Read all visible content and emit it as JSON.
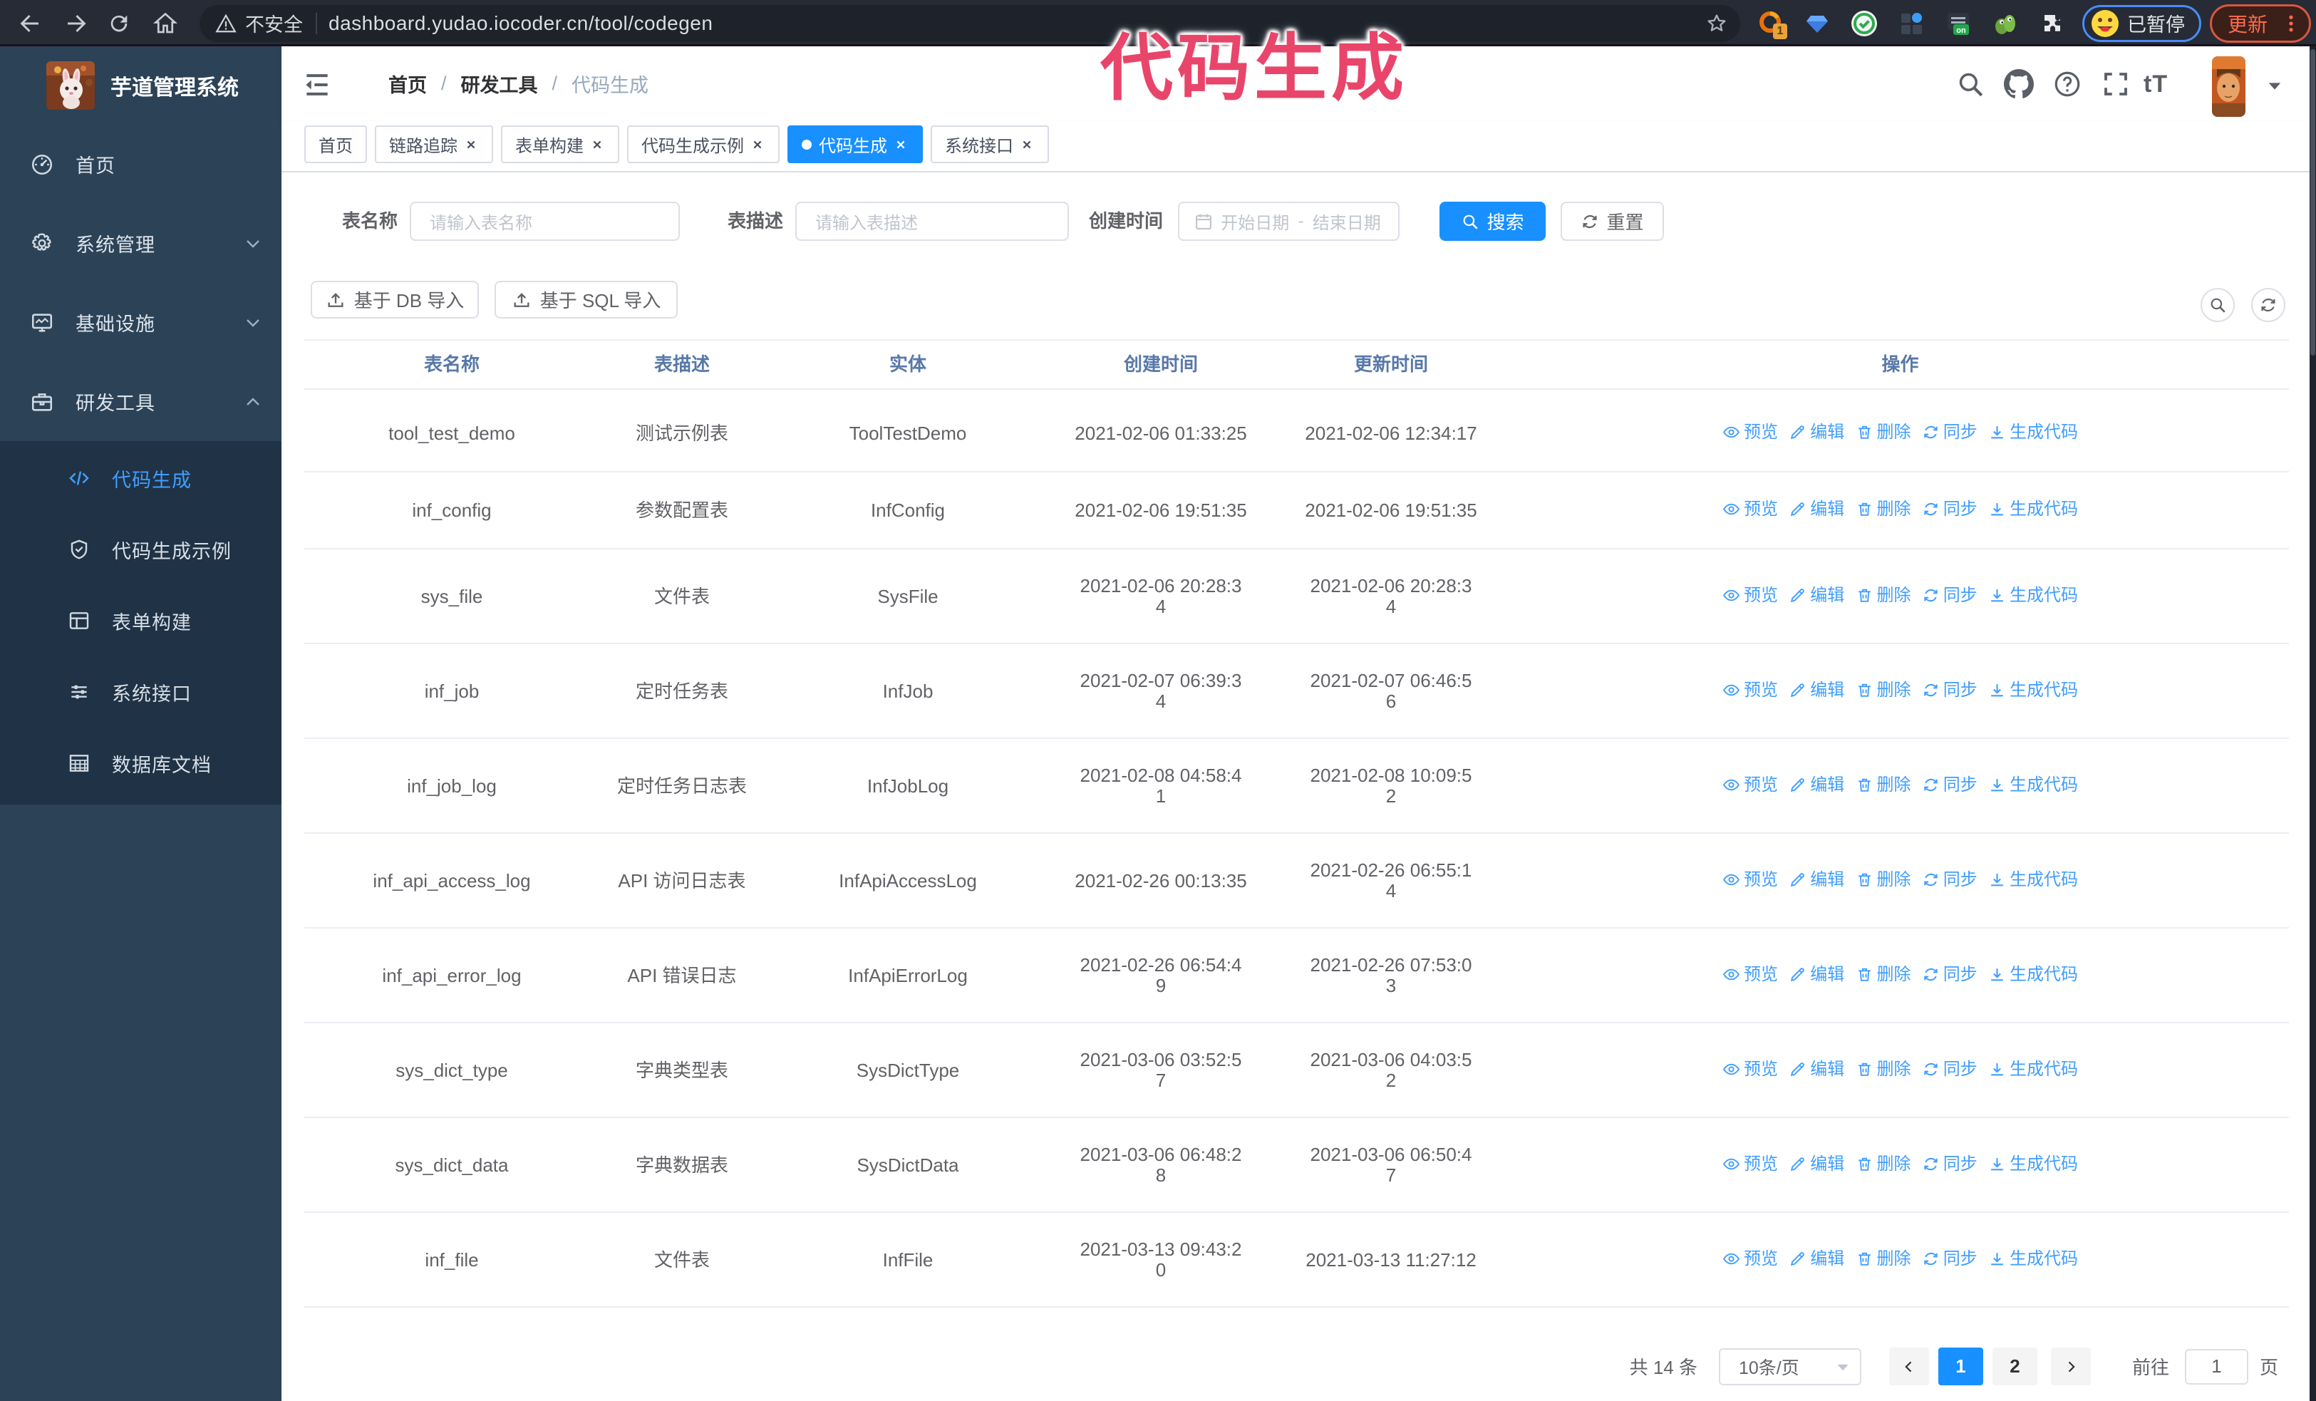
{
  "browser": {
    "security_label": "不安全",
    "url": "dashboard.yudao.iocoder.cn/tool/codegen",
    "extension_badge": "1",
    "extension_on_badge": "on",
    "paused_label": "已暂停",
    "update_label": "更新"
  },
  "annotation": {
    "text": "代码生成"
  },
  "sidebar": {
    "logo_title": "芋道管理系统",
    "items": [
      {
        "label": "首页",
        "icon": "gauge-icon",
        "arrow": ""
      },
      {
        "label": "系统管理",
        "icon": "gear-icon",
        "arrow": "down"
      },
      {
        "label": "基础设施",
        "icon": "monitor-icon",
        "arrow": "down"
      },
      {
        "label": "研发工具",
        "icon": "briefcase-icon",
        "arrow": "up"
      }
    ],
    "subitems": [
      {
        "label": "代码生成",
        "icon": "code-icon",
        "active": true
      },
      {
        "label": "代码生成示例",
        "icon": "badge-icon",
        "active": false
      },
      {
        "label": "表单构建",
        "icon": "form-icon",
        "active": false
      },
      {
        "label": "系统接口",
        "icon": "sliders-icon",
        "active": false
      },
      {
        "label": "数据库文档",
        "icon": "dbtable-icon",
        "active": false
      }
    ]
  },
  "header": {
    "breadcrumb": [
      "首页",
      "研发工具",
      "代码生成"
    ],
    "separator": "/"
  },
  "tags": [
    {
      "label": "首页",
      "closable": false,
      "active": false
    },
    {
      "label": "链路追踪",
      "closable": true,
      "active": false
    },
    {
      "label": "表单构建",
      "closable": true,
      "active": false
    },
    {
      "label": "代码生成示例",
      "closable": true,
      "active": false
    },
    {
      "label": "代码生成",
      "closable": true,
      "active": true
    },
    {
      "label": "系统接口",
      "closable": true,
      "active": false
    }
  ],
  "filters": {
    "name_label": "表名称",
    "name_placeholder": "请输入表名称",
    "desc_label": "表描述",
    "desc_placeholder": "请输入表描述",
    "time_label": "创建时间",
    "start_placeholder": "开始日期",
    "range_separator": "-",
    "end_placeholder": "结束日期",
    "search_label": "搜索",
    "reset_label": "重置"
  },
  "toolbar": {
    "import_db_label": "基于 DB 导入",
    "import_sql_label": "基于 SQL 导入"
  },
  "table": {
    "columns": [
      "表名称",
      "表描述",
      "实体",
      "创建时间",
      "更新时间",
      "操作"
    ],
    "action_labels": [
      "预览",
      "编辑",
      "删除",
      "同步",
      "生成代码"
    ],
    "action_icons": [
      "eye-icon",
      "edit-icon",
      "delete-icon",
      "sync-icon",
      "download-icon"
    ],
    "rows": [
      {
        "name": "tool_test_demo",
        "desc": "测试示例表",
        "entity": "ToolTestDemo",
        "created": "2021-02-06 01:33:25",
        "updated": "2021-02-06 12:34:17"
      },
      {
        "name": "inf_config",
        "desc": "参数配置表",
        "entity": "InfConfig",
        "created": "2021-02-06 19:51:35",
        "updated": "2021-02-06 19:51:35"
      },
      {
        "name": "sys_file",
        "desc": "文件表",
        "entity": "SysFile",
        "created": "2021-02-06 20:28:3\n4",
        "updated": "2021-02-06 20:28:3\n4"
      },
      {
        "name": "inf_job",
        "desc": "定时任务表",
        "entity": "InfJob",
        "created": "2021-02-07 06:39:3\n4",
        "updated": "2021-02-07 06:46:5\n6"
      },
      {
        "name": "inf_job_log",
        "desc": "定时任务日志表",
        "entity": "InfJobLog",
        "created": "2021-02-08 04:58:4\n1",
        "updated": "2021-02-08 10:09:5\n2"
      },
      {
        "name": "inf_api_access_log",
        "desc": "API 访问日志表",
        "entity": "InfApiAccessLog",
        "created": "2021-02-26 00:13:35",
        "updated": "2021-02-26 06:55:1\n4"
      },
      {
        "name": "inf_api_error_log",
        "desc": "API 错误日志",
        "entity": "InfApiErrorLog",
        "created": "2021-02-26 06:54:4\n9",
        "updated": "2021-02-26 07:53:0\n3"
      },
      {
        "name": "sys_dict_type",
        "desc": "字典类型表",
        "entity": "SysDictType",
        "created": "2021-03-06 03:52:5\n7",
        "updated": "2021-03-06 04:03:5\n2"
      },
      {
        "name": "sys_dict_data",
        "desc": "字典数据表",
        "entity": "SysDictData",
        "created": "2021-03-06 06:48:2\n8",
        "updated": "2021-03-06 06:50:4\n7"
      },
      {
        "name": "inf_file",
        "desc": "文件表",
        "entity": "InfFile",
        "created": "2021-03-13 09:43:2\n0",
        "updated": "2021-03-13 11:27:12"
      }
    ]
  },
  "pagination": {
    "total": "共 14 条",
    "page_size": "10条/页",
    "pages": [
      "1",
      "2"
    ],
    "active_page": "1",
    "goto_label": "前往",
    "goto_value": "1",
    "page_label": "页"
  }
}
